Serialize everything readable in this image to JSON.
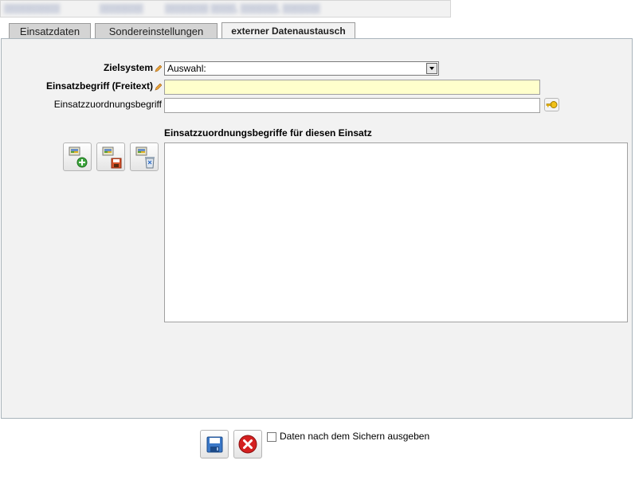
{
  "header": {
    "blurred_segments": [
      "▒▒▒▒▒▒▒▒▒",
      "▒▒▒▒▒▒▒",
      "▒▒▒▒▒▒▒ ▒▒▒▒, ▒▒▒▒▒▒, ▒▒▒▒▒▒"
    ]
  },
  "tabs": [
    {
      "label": "Einsatzdaten",
      "active": false
    },
    {
      "label": "Sondereinstellungen",
      "active": false
    },
    {
      "label": "externer Datenaustausch",
      "active": true
    }
  ],
  "form": {
    "zielsystem_label": "Zielsystem",
    "zielsystem_value": "Auswahl:",
    "einsatzbegriff_label": "Einsatzbegriff (Freitext)",
    "einsatzbegriff_value": "",
    "zuordnung_label": "Einsatzzuordnungsbegriff",
    "zuordnung_value": ""
  },
  "list_section": {
    "title": "Einsatzzuordnungsbegriffe für diesen Einsatz",
    "items": []
  },
  "footer": {
    "checkbox_label": "Daten nach dem Sichern ausgeben",
    "checkbox_checked": false
  },
  "colors": {
    "panel_bg": "#f2f2f2",
    "required_field_bg": "#ffffcc",
    "cancel_red": "#d42020"
  }
}
